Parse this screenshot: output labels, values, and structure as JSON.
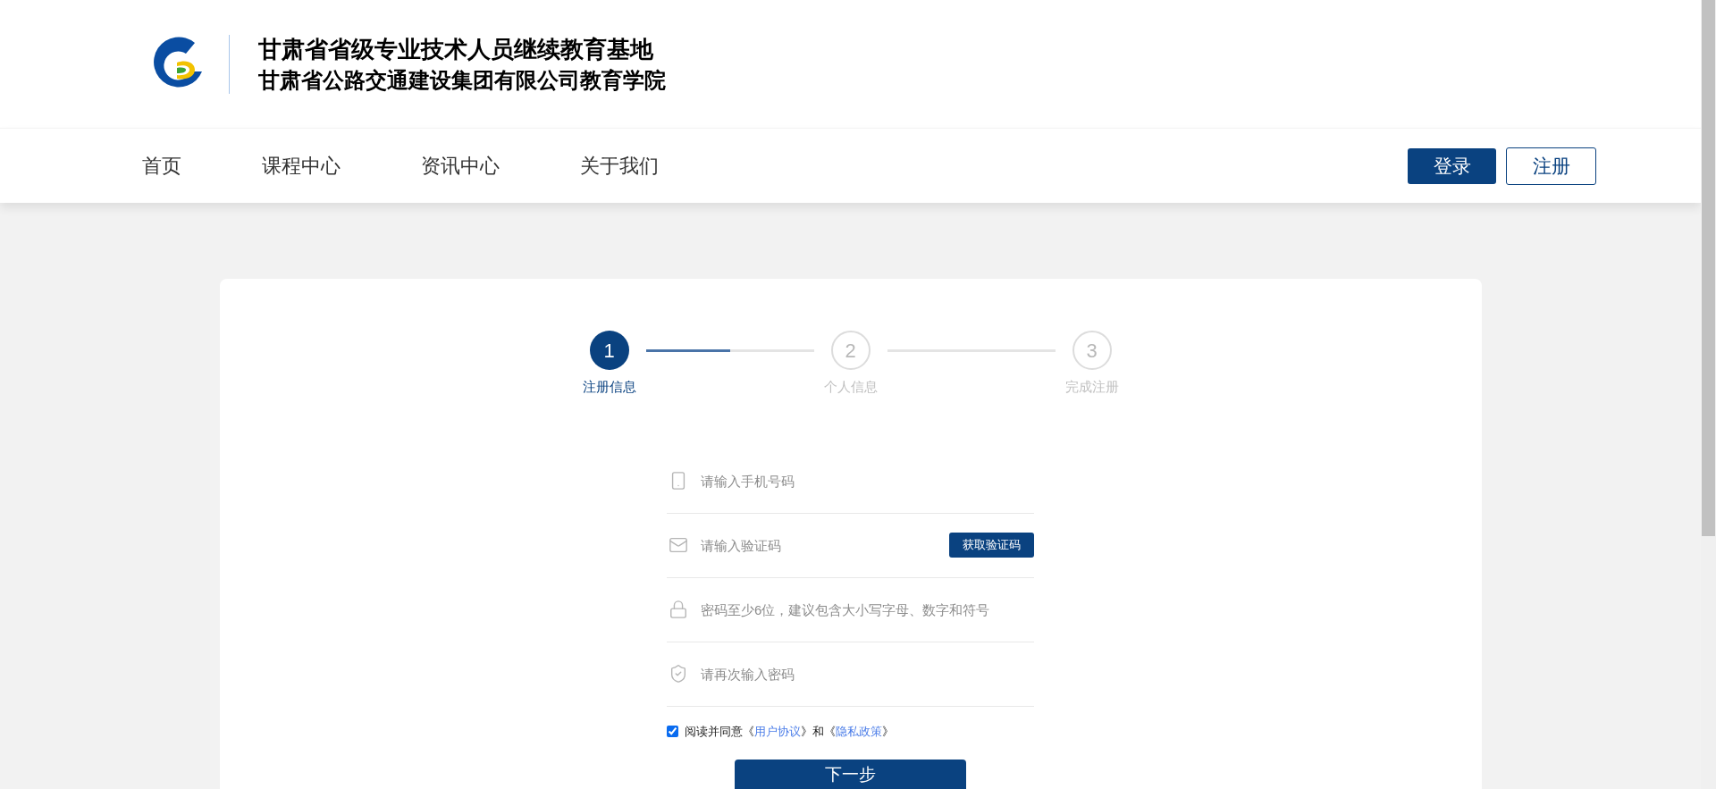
{
  "header": {
    "title": "甘肃省省级专业技术人员继续教育基地",
    "subtitle": "甘肃省公路交通建设集团有限公司教育学院"
  },
  "nav": {
    "items": [
      {
        "label": "首页"
      },
      {
        "label": "课程中心"
      },
      {
        "label": "资讯中心"
      },
      {
        "label": "关于我们"
      }
    ],
    "login_button": "登录",
    "register_button": "注册"
  },
  "steps": [
    {
      "number": "1",
      "label": "注册信息",
      "active": true
    },
    {
      "number": "2",
      "label": "个人信息",
      "active": false
    },
    {
      "number": "3",
      "label": "完成注册",
      "active": false
    }
  ],
  "connectors": [
    {
      "level": 0.5
    },
    {
      "level": 0
    }
  ],
  "fields": [
    {
      "kind": "phone",
      "placeholder": "请输入手机号码"
    },
    {
      "kind": "code",
      "placeholder": "请输入验证码",
      "button": "获取验证码"
    },
    {
      "kind": "password",
      "placeholder": "密码至少6位，建议包含大小写字母、数字和符号"
    },
    {
      "kind": "confirm",
      "placeholder": "请再次输入密码"
    }
  ],
  "agreement": {
    "checked": true,
    "before": "阅读并同意《",
    "link_1": "用户协议",
    "middle": "》和《",
    "link_2": "隐私政策",
    "after": "》"
  },
  "submit_button": "下一步"
}
